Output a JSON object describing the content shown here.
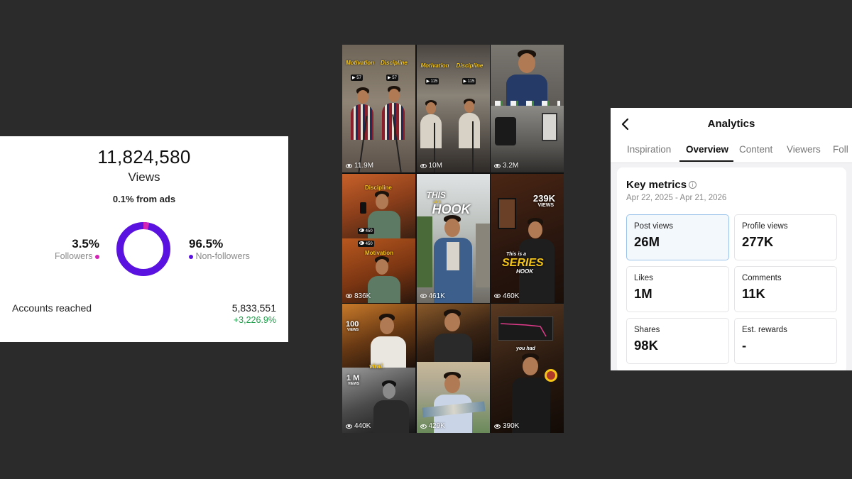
{
  "insights": {
    "views_total": "11,824,580",
    "views_label": "Views",
    "ads_pct": "0.1%",
    "ads_text": "from ads",
    "followers_pct": "3.5%",
    "followers_label": "Followers",
    "nonfollowers_pct": "96.5%",
    "nonfollowers_label": "Non-followers",
    "followers_share": 0.035,
    "colors": {
      "followers": "#d424b6",
      "nonfollowers": "#5a12e0",
      "positive": "#1f9e4a"
    },
    "reached_label": "Accounts reached",
    "reached_value": "5,833,551",
    "reached_delta": "+3,226.9%"
  },
  "grid": {
    "tiles": [
      {
        "views": "11.9M",
        "overlay": [
          "Motivation",
          "Discipline"
        ],
        "mini": [
          "57",
          "57"
        ]
      },
      {
        "views": "10M",
        "overlay": [
          "Motivation",
          "Discipline"
        ],
        "mini": [
          "115",
          "115"
        ]
      },
      {
        "views": "3.2M"
      },
      {
        "views": "836K",
        "overlay": [
          "Discipline",
          "Motivation"
        ],
        "mini": [
          "450",
          "450"
        ]
      },
      {
        "views": "461K",
        "overlay": [
          "THIS",
          "is a",
          "HOOK"
        ]
      },
      {
        "views": "460K",
        "overlay": [
          "239K",
          "VIEWS",
          "This is a",
          "SERIES",
          "HOOK"
        ]
      },
      {
        "views": "440K",
        "overlay": [
          "100",
          "VIEWS",
          "viral.",
          "1 M",
          "VIEWS"
        ]
      },
      {
        "views": "429K"
      },
      {
        "views": "390K",
        "overlay": [
          "you had"
        ]
      }
    ]
  },
  "analytics": {
    "title": "Analytics",
    "tabs": [
      "Inspiration",
      "Overview",
      "Content",
      "Viewers",
      "Foll"
    ],
    "active_tab": "Overview",
    "key_metrics_title": "Key metrics",
    "date_range": "Apr 22, 2025 - Apr 21, 2026",
    "metrics": [
      {
        "label": "Post views",
        "value": "26M",
        "selected": true
      },
      {
        "label": "Profile views",
        "value": "277K"
      },
      {
        "label": "Likes",
        "value": "1M"
      },
      {
        "label": "Comments",
        "value": "11K"
      },
      {
        "label": "Shares",
        "value": "98K"
      },
      {
        "label": "Est. rewards",
        "value": "-"
      }
    ]
  }
}
